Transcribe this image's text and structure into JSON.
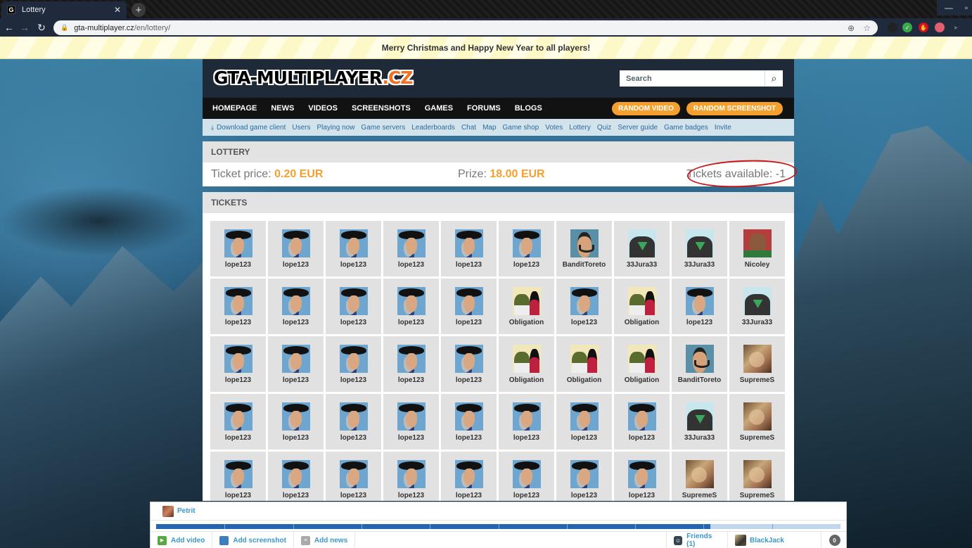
{
  "browser": {
    "tab_title": "Lottery",
    "tab_favicon": "G",
    "new_tab_icon": "+",
    "url_host": "gta-multiplayer.cz",
    "url_path": "/en/lottery/",
    "icons": [
      "back-arrow-icon",
      "forward-arrow-icon",
      "reload-icon",
      "lock-icon",
      "zoom-icon",
      "star-icon"
    ]
  },
  "announcement": "Merry Christmas and Happy New Year to all players!",
  "header": {
    "logo_main": "GTA-MULTIPLAYER",
    "logo_tld": ".CZ",
    "search_placeholder": "Search"
  },
  "main_nav": {
    "items": [
      "HOMEPAGE",
      "NEWS",
      "VIDEOS",
      "SCREENSHOTS",
      "GAMES",
      "FORUMS",
      "BLOGS"
    ],
    "random_video": "RANDOM VIDEO",
    "random_screenshot": "RANDOM SCREENSHOT"
  },
  "sub_nav": {
    "items": [
      "Download game client",
      "Users",
      "Playing now",
      "Game servers",
      "Leaderboards",
      "Chat",
      "Map",
      "Game shop",
      "Votes",
      "Lottery",
      "Quiz",
      "Server guide",
      "Game badges",
      "Invite"
    ]
  },
  "lottery": {
    "heading": "LOTTERY",
    "ticket_price_label": "Ticket price: ",
    "ticket_price_value": "0.20 EUR",
    "prize_label": "Prize: ",
    "prize_value": "18.00 EUR",
    "tickets_available": "Tickets available: -1",
    "annotation": "red hand-drawn circle around tickets available"
  },
  "tickets": {
    "heading": "TICKETS",
    "rows": [
      [
        {
          "name": "lope123",
          "avatar": "cowboy"
        },
        {
          "name": "lope123",
          "avatar": "cowboy"
        },
        {
          "name": "lope123",
          "avatar": "cowboy"
        },
        {
          "name": "lope123",
          "avatar": "cowboy"
        },
        {
          "name": "lope123",
          "avatar": "cowboy"
        },
        {
          "name": "lope123",
          "avatar": "cowboy"
        },
        {
          "name": "BanditToreto",
          "avatar": "bandit"
        },
        {
          "name": "33Jura33",
          "avatar": "jura"
        },
        {
          "name": "33Jura33",
          "avatar": "jura"
        },
        {
          "name": "Nicoley",
          "avatar": "nicoley"
        }
      ],
      [
        {
          "name": "lope123",
          "avatar": "cowboy"
        },
        {
          "name": "lope123",
          "avatar": "cowboy"
        },
        {
          "name": "lope123",
          "avatar": "cowboy"
        },
        {
          "name": "lope123",
          "avatar": "cowboy"
        },
        {
          "name": "lope123",
          "avatar": "cowboy"
        },
        {
          "name": "Obligation",
          "avatar": "obligation"
        },
        {
          "name": "lope123",
          "avatar": "cowboy"
        },
        {
          "name": "Obligation",
          "avatar": "obligation"
        },
        {
          "name": "lope123",
          "avatar": "cowboy"
        },
        {
          "name": "33Jura33",
          "avatar": "jura"
        }
      ],
      [
        {
          "name": "lope123",
          "avatar": "cowboy"
        },
        {
          "name": "lope123",
          "avatar": "cowboy"
        },
        {
          "name": "lope123",
          "avatar": "cowboy"
        },
        {
          "name": "lope123",
          "avatar": "cowboy"
        },
        {
          "name": "lope123",
          "avatar": "cowboy"
        },
        {
          "name": "Obligation",
          "avatar": "obligation"
        },
        {
          "name": "Obligation",
          "avatar": "obligation"
        },
        {
          "name": "Obligation",
          "avatar": "obligation"
        },
        {
          "name": "BanditToreto",
          "avatar": "bandit"
        },
        {
          "name": "SupremeS",
          "avatar": "supreme"
        }
      ],
      [
        {
          "name": "lope123",
          "avatar": "cowboy"
        },
        {
          "name": "lope123",
          "avatar": "cowboy"
        },
        {
          "name": "lope123",
          "avatar": "cowboy"
        },
        {
          "name": "lope123",
          "avatar": "cowboy"
        },
        {
          "name": "lope123",
          "avatar": "cowboy"
        },
        {
          "name": "lope123",
          "avatar": "cowboy"
        },
        {
          "name": "lope123",
          "avatar": "cowboy"
        },
        {
          "name": "lope123",
          "avatar": "cowboy"
        },
        {
          "name": "33Jura33",
          "avatar": "jura"
        },
        {
          "name": "SupremeS",
          "avatar": "supreme"
        }
      ],
      [
        {
          "name": "lope123",
          "avatar": "cowboy"
        },
        {
          "name": "lope123",
          "avatar": "cowboy"
        },
        {
          "name": "lope123",
          "avatar": "cowboy"
        },
        {
          "name": "lope123",
          "avatar": "cowboy"
        },
        {
          "name": "lope123",
          "avatar": "cowboy"
        },
        {
          "name": "lope123",
          "avatar": "cowboy"
        },
        {
          "name": "lope123",
          "avatar": "cowboy"
        },
        {
          "name": "lope123",
          "avatar": "cowboy"
        },
        {
          "name": "SupremeS",
          "avatar": "supreme"
        },
        {
          "name": "SupremeS",
          "avatar": "supreme"
        }
      ]
    ]
  },
  "bottom_bar": {
    "current_user": "Petrit",
    "progress_percent": 81,
    "progress_segments": 10,
    "add_video": "Add video",
    "add_screenshot": "Add screenshot",
    "add_news": "Add news",
    "friends": "Friends (1)",
    "friend_user": "BlackJack",
    "notifications_count": "0"
  },
  "colors": {
    "accent_orange": "#f5a02c",
    "link_blue": "#2b6a9a",
    "progress_blue": "#2467b0",
    "annotation_red": "#c51818"
  }
}
